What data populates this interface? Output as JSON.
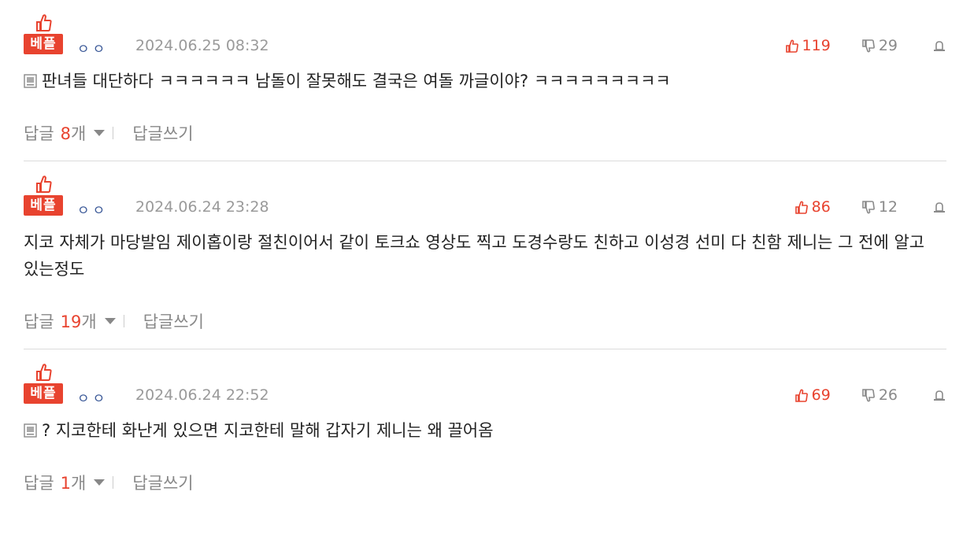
{
  "comments": [
    {
      "badge": "베플",
      "nickname": "ㅇㅇ",
      "date": "2024.06.25 08:32",
      "likes": "119",
      "dislikes": "29",
      "text": "판녀들 대단하다 ㅋㅋㅋㅋㅋㅋ 남돌이 잘못해도 결국은 여돌 까글이야? ㅋㅋㅋㅋㅋㅋㅋㅋㅋ",
      "reply_label": "답글",
      "reply_count": "8",
      "reply_unit": "개",
      "write_label": "답글쓰기"
    },
    {
      "badge": "베플",
      "nickname": "ㅇㅇ",
      "date": "2024.06.24 23:28",
      "likes": "86",
      "dislikes": "12",
      "text": "지코 자체가 마당발임 제이홉이랑 절친이어서 같이 토크쇼 영상도 찍고 도경수랑도 친하고 이성경 선미 다 친함 제니는 그 전에 알고 있는정도",
      "reply_label": "답글",
      "reply_count": "19",
      "reply_unit": "개",
      "write_label": "답글쓰기"
    },
    {
      "badge": "베플",
      "nickname": "ㅇㅇ",
      "date": "2024.06.24 22:52",
      "likes": "69",
      "dislikes": "26",
      "text": "? 지코한테 화난게 있으면 지코한테 말해 갑자기 제니는 왜 끌어옴",
      "reply_label": "답글",
      "reply_count": "1",
      "reply_unit": "개",
      "write_label": "답글쓰기"
    }
  ],
  "icons": {
    "best": "thumbs-up-icon",
    "like": "thumbs-up-icon",
    "dislike": "thumbs-down-icon",
    "report": "report-icon",
    "memo": "memo-icon",
    "expand": "caret-down-icon"
  },
  "colors": {
    "accent": "#e8432f",
    "nickname": "#3b5998",
    "muted": "#888888"
  }
}
